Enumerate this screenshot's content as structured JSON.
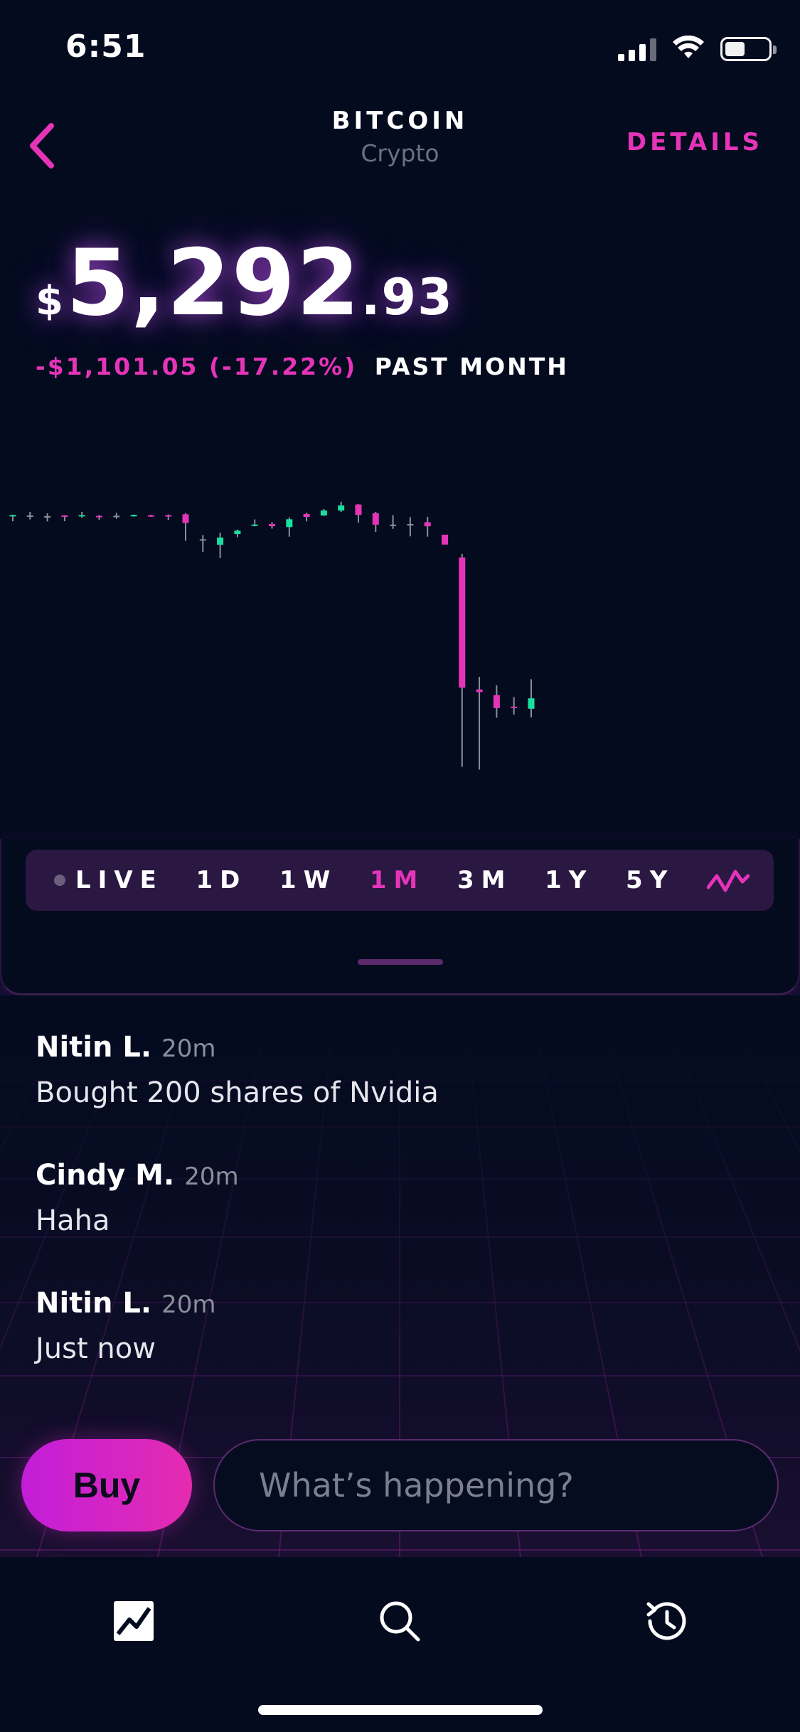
{
  "status_bar": {
    "time": "6:51",
    "battery_level": 0.45
  },
  "header": {
    "asset_name": "BITCOIN",
    "asset_type": "Crypto",
    "details_label": "DETAILS"
  },
  "price": {
    "currency": "$",
    "main": "5,292",
    "cents": ".93",
    "change": "-$1,101.05 (-17.22%)",
    "period": "PAST MONTH"
  },
  "colors": {
    "accent": "#e534b8",
    "up": "#19e0a0",
    "down": "#e534b8",
    "background": "#040b1f"
  },
  "chart_data": {
    "type": "candlestick",
    "candles": [
      {
        "d": "up",
        "o": 5.9,
        "c": 4.3,
        "h": 3.9,
        "l": 13.2
      },
      {
        "d": "doji",
        "o": 5.0,
        "c": 5.0,
        "h": 0,
        "l": 10.5
      },
      {
        "d": "doji",
        "o": 6.0,
        "c": 6.0,
        "h": 2,
        "l": 13.4
      },
      {
        "d": "down",
        "o": 5.0,
        "c": 7.0,
        "h": 4.5,
        "l": 13.1
      },
      {
        "d": "up",
        "o": 6.4,
        "c": 4.4,
        "h": 0,
        "l": 8.3
      },
      {
        "d": "down",
        "o": 5.6,
        "c": 6.8,
        "h": 4.2,
        "l": 11.0
      },
      {
        "d": "doji",
        "o": 5.4,
        "c": 5.4,
        "h": 1.2,
        "l": 9.7
      },
      {
        "d": "up",
        "o": 5.4,
        "c": 4.2,
        "h": 3.9,
        "l": 6.7
      },
      {
        "d": "down",
        "o": 4.7,
        "c": 5.8,
        "h": 4.0,
        "l": 6.9
      },
      {
        "d": "down",
        "o": 4.6,
        "c": 6.1,
        "h": 3.6,
        "l": 11.4
      },
      {
        "d": "down",
        "o": 3.3,
        "c": 15.6,
        "h": 1.6,
        "l": 40.5
      },
      {
        "d": "doji",
        "o": 38.4,
        "c": 38.4,
        "h": 32.5,
        "l": 56.1
      },
      {
        "d": "up",
        "o": 46.2,
        "c": 36.1,
        "h": 29.2,
        "l": 64.9
      },
      {
        "d": "up",
        "o": 31.0,
        "c": 26.4,
        "h": 24.8,
        "l": 35.7
      },
      {
        "d": "up",
        "o": 19.4,
        "c": 17.7,
        "h": 10.5,
        "l": 20.4
      },
      {
        "d": "down",
        "o": 17.0,
        "c": 20.1,
        "h": 14.6,
        "l": 23.5
      },
      {
        "d": "up",
        "o": 21.3,
        "c": 10.3,
        "h": 7.5,
        "l": 34.8
      },
      {
        "d": "down",
        "o": 3.0,
        "c": 7.1,
        "h": 1.0,
        "l": 13.3
      },
      {
        "d": "up",
        "o": 5.0,
        "c": -2.1,
        "h": -4.0,
        "l": 5.6
      },
      {
        "d": "up",
        "o": -2.0,
        "c": -9.2,
        "h": -14.3,
        "l": 0.0
      },
      {
        "d": "down",
        "o": -10.4,
        "c": 4.2,
        "h": -11.0,
        "l": 15.2
      },
      {
        "d": "down",
        "o": 1.8,
        "c": 17.9,
        "h": 0,
        "l": 28.2
      },
      {
        "d": "doji",
        "o": 17.8,
        "c": 17.8,
        "h": 4.5,
        "l": 23.8
      },
      {
        "d": "doji",
        "o": 17.0,
        "c": 17.0,
        "h": 7.3,
        "l": 34.3
      },
      {
        "d": "down",
        "o": 14.5,
        "c": 20.2,
        "h": 6.9,
        "l": 34.8
      },
      {
        "d": "down",
        "o": 32.0,
        "c": 45.9,
        "h": 32.0,
        "l": 45.9
      },
      {
        "d": "down",
        "o": 64.2,
        "c": 247.1,
        "h": 59.0,
        "l": 358.5
      },
      {
        "d": "down",
        "o": 249.7,
        "c": 253.4,
        "h": 232.0,
        "l": 362.4
      },
      {
        "d": "down",
        "o": 257.6,
        "c": 275.9,
        "h": 243.7,
        "l": 289.5
      },
      {
        "d": "down",
        "o": 273.9,
        "c": 275.9,
        "h": 260.5,
        "l": 285.1
      },
      {
        "d": "up",
        "o": 276.8,
        "c": 262.2,
        "h": 235.3,
        "l": 289.1
      }
    ]
  },
  "range_selector": {
    "live_label": "LIVE",
    "ranges": [
      "1D",
      "1W",
      "1M",
      "3M",
      "1Y",
      "5Y"
    ],
    "active": "1M"
  },
  "feed": [
    {
      "author": "Nitin L.",
      "time": "20m",
      "text": "Bought 200 shares of Nvidia"
    },
    {
      "author": "Cindy M.",
      "time": "20m",
      "text": "Haha"
    },
    {
      "author": "Nitin L.",
      "time": "20m",
      "text": "Just now"
    }
  ],
  "actions": {
    "buy_label": "Buy",
    "message_placeholder": "What’s happening?"
  },
  "tabs": [
    {
      "name": "chart-icon"
    },
    {
      "name": "search-icon"
    },
    {
      "name": "history-icon"
    }
  ]
}
